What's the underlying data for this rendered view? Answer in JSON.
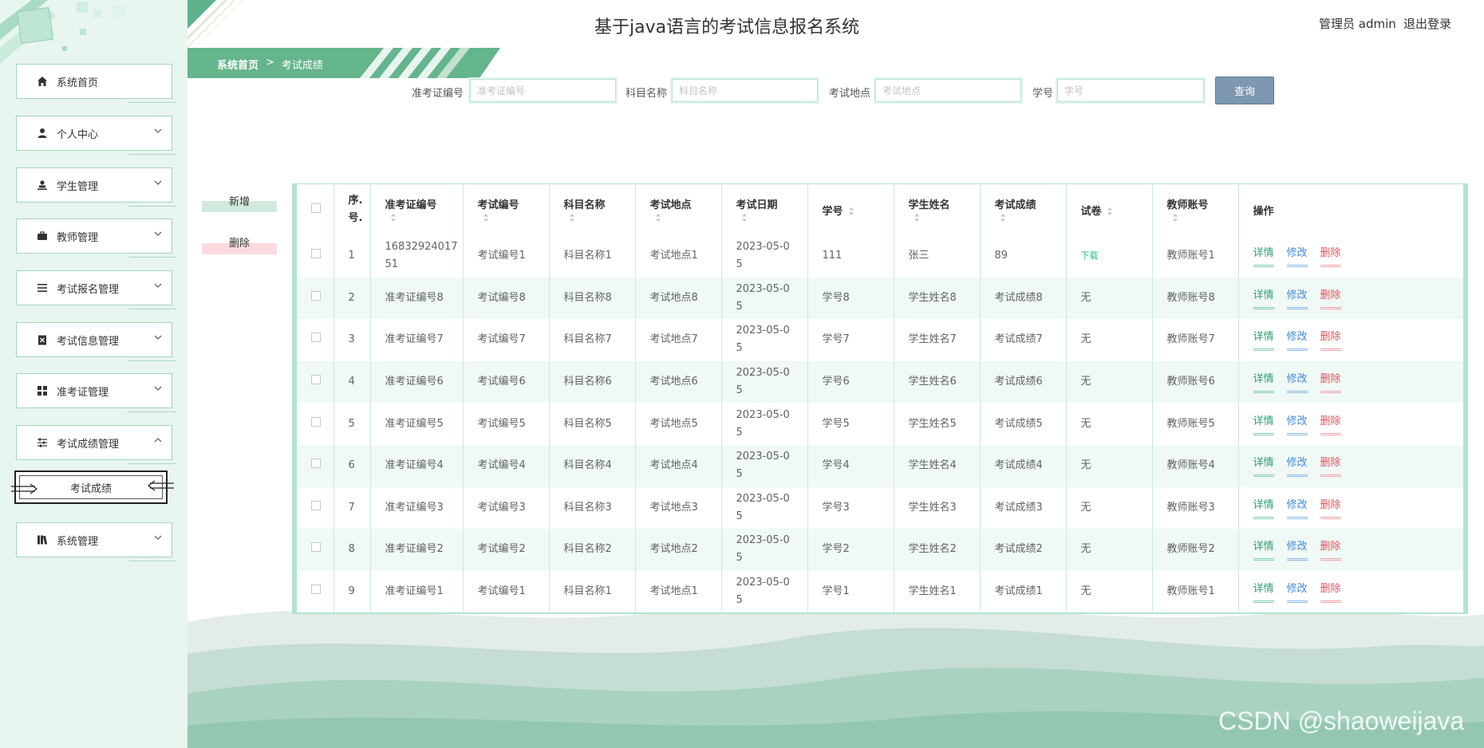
{
  "header": {
    "title": "基于java语言的考试信息报名系统",
    "admin": "管理员 admin",
    "logout": "退出登录"
  },
  "breadcrumb": {
    "home": "系统首页",
    "sep": ">",
    "current": "考试成绩"
  },
  "sidebar": {
    "items": [
      {
        "label": "系统首页",
        "icon": "home-icon"
      },
      {
        "label": "个人中心",
        "icon": "user-icon"
      },
      {
        "label": "学生管理",
        "icon": "student-icon"
      },
      {
        "label": "教师管理",
        "icon": "briefcase-icon"
      },
      {
        "label": "考试报名管理",
        "icon": "list-icon"
      },
      {
        "label": "考试信息管理",
        "icon": "clipboard-x-icon"
      },
      {
        "label": "准考证管理",
        "icon": "grid-icon"
      },
      {
        "label": "考试成绩管理",
        "icon": "sliders-icon"
      },
      {
        "label": "系统管理",
        "icon": "book-icon"
      }
    ],
    "submenu": {
      "label": "考试成绩"
    }
  },
  "search": {
    "fields": [
      {
        "label": "准考证编号",
        "placeholder": "准考证编号",
        "value": ""
      },
      {
        "label": "科目名称",
        "placeholder": "科目名称",
        "value": ""
      },
      {
        "label": "考试地点",
        "placeholder": "考试地点",
        "value": ""
      },
      {
        "label": "学号",
        "placeholder": "学号",
        "value": ""
      }
    ],
    "button": "查询"
  },
  "actions": {
    "add": "新增",
    "delete": "删除"
  },
  "table": {
    "headers": [
      "序.号.",
      "准考证编号",
      "考试编号",
      "科目名称",
      "考试地点",
      "考试日期",
      "学号",
      "学生姓名",
      "考试成绩",
      "试卷",
      "教师账号",
      "操作"
    ],
    "ops": {
      "detail": "详情",
      "edit": "修改",
      "delete": "删除"
    },
    "rows": [
      {
        "idx": "1",
        "ticket": "1683292401751",
        "exam": "考试编号1",
        "subject": "科目名称1",
        "place": "考试地点1",
        "date": "2023-05-05",
        "sid": "111",
        "name": "张三",
        "score": "89",
        "paper": "下载",
        "teacher": "教师账号1"
      },
      {
        "idx": "2",
        "ticket": "准考证编号8",
        "exam": "考试编号8",
        "subject": "科目名称8",
        "place": "考试地点8",
        "date": "2023-05-05",
        "sid": "学号8",
        "name": "学生姓名8",
        "score": "考试成绩8",
        "paper": "无",
        "teacher": "教师账号8"
      },
      {
        "idx": "3",
        "ticket": "准考证编号7",
        "exam": "考试编号7",
        "subject": "科目名称7",
        "place": "考试地点7",
        "date": "2023-05-05",
        "sid": "学号7",
        "name": "学生姓名7",
        "score": "考试成绩7",
        "paper": "无",
        "teacher": "教师账号7"
      },
      {
        "idx": "4",
        "ticket": "准考证编号6",
        "exam": "考试编号6",
        "subject": "科目名称6",
        "place": "考试地点6",
        "date": "2023-05-05",
        "sid": "学号6",
        "name": "学生姓名6",
        "score": "考试成绩6",
        "paper": "无",
        "teacher": "教师账号6"
      },
      {
        "idx": "5",
        "ticket": "准考证编号5",
        "exam": "考试编号5",
        "subject": "科目名称5",
        "place": "考试地点5",
        "date": "2023-05-05",
        "sid": "学号5",
        "name": "学生姓名5",
        "score": "考试成绩5",
        "paper": "无",
        "teacher": "教师账号5"
      },
      {
        "idx": "6",
        "ticket": "准考证编号4",
        "exam": "考试编号4",
        "subject": "科目名称4",
        "place": "考试地点4",
        "date": "2023-05-05",
        "sid": "学号4",
        "name": "学生姓名4",
        "score": "考试成绩4",
        "paper": "无",
        "teacher": "教师账号4"
      },
      {
        "idx": "7",
        "ticket": "准考证编号3",
        "exam": "考试编号3",
        "subject": "科目名称3",
        "place": "考试地点3",
        "date": "2023-05-05",
        "sid": "学号3",
        "name": "学生姓名3",
        "score": "考试成绩3",
        "paper": "无",
        "teacher": "教师账号3"
      },
      {
        "idx": "8",
        "ticket": "准考证编号2",
        "exam": "考试编号2",
        "subject": "科目名称2",
        "place": "考试地点2",
        "date": "2023-05-05",
        "sid": "学号2",
        "name": "学生姓名2",
        "score": "考试成绩2",
        "paper": "无",
        "teacher": "教师账号2"
      },
      {
        "idx": "9",
        "ticket": "准考证编号1",
        "exam": "考试编号1",
        "subject": "科目名称1",
        "place": "考试地点1",
        "date": "2023-05-05",
        "sid": "学号1",
        "name": "学生姓名1",
        "score": "考试成绩1",
        "paper": "无",
        "teacher": "教师账号1"
      }
    ]
  },
  "watermark": "CSDN @shaoweijava",
  "colors": {
    "accent": "#5fb38c",
    "sidebar_bg": "#e9f5ef",
    "table_border": "#b1e4ce",
    "query_btn": "#7d98b0"
  }
}
